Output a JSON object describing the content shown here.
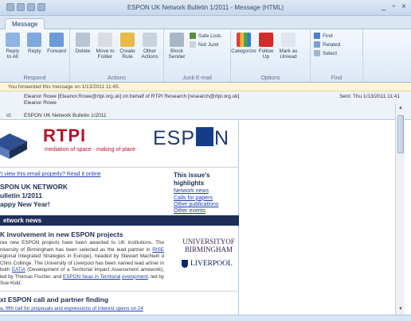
{
  "window": {
    "title": "ESPON UK Network Bulletin 1/2011 - Message (HTML)",
    "controls": [
      "_",
      "▫",
      "×"
    ]
  },
  "tabs": [
    "Message"
  ],
  "ribbon": {
    "groups": [
      {
        "label": "Respond",
        "buttons": [
          "Reply to All",
          "Reply",
          "Forward"
        ]
      },
      {
        "label": "Actions",
        "buttons": [
          "Delete",
          "Move to Folder",
          "Create Rule",
          "Other Actions"
        ]
      },
      {
        "label": "Junk E-mail",
        "buttons": [
          "Block Sender",
          "Safe Lists",
          "Not Junk"
        ]
      },
      {
        "label": "Options",
        "buttons": [
          "Categorize",
          "Follow Up",
          "Mark as Unread"
        ]
      },
      {
        "label": "Find",
        "buttons": [
          "Find",
          "Related",
          "Select"
        ]
      }
    ]
  },
  "infobar": "You forwarded this message on 1/13/2011 11:45.",
  "header": {
    "from": "Eleanor Rowe [Eleanor.Rowe@rtpi.org.uk] on behalf of RTPI Research [research@rtpi.org.uk]",
    "to": "Eleanor Rowe",
    "sent": "Sent:  Thu 1/13/2011 11:41",
    "subject_label": "ct:",
    "subject": "ESPON UK Network Bulletin 1/2011"
  },
  "newsletter": {
    "rtpi_name": "RTPI",
    "rtpi_tagline": "mediation of space · making of place",
    "espon_left": "ESP",
    "espon_right": "N",
    "view_link": "'t view this email properly? Read it online",
    "name_lines": [
      "SPON UK NETWORK",
      "ulletin 1/2011",
      "appy New Year!"
    ],
    "highlights": {
      "heading": "This issue's highlights",
      "links": [
        "Network news",
        "Calls for papers",
        "Other publications",
        "Other events"
      ]
    },
    "section": "etwork news",
    "article1_title": "K involvement in new ESPON projects",
    "article1_pre": "ree new ESPON projects have been awarded to UK institutions. The niversity of Birmingham has been selected as the lead partner in ",
    "article1_link1": "RISE",
    "article1_mid1": " egional Integrated Strategies in Europe), headed by Stewart MacNeill d Chris Collinge. The University of Liverpool has been named lead artner in both ",
    "article1_link2": "EATiA",
    "article1_mid2": " (Development of a Territorial Impact Assessment amework), led by Thomas Fischer, and ",
    "article1_link3": "ESPON Seas in Territorial",
    "article1_link4": "evelopment",
    "article1_post": ", led by Sue Kidd.",
    "uob": [
      "UNIVERSITYOF",
      "BIRMINGHAM"
    ],
    "uol": "LIVERPOOL",
    "article2_title": "xt ESPON call and partner finding",
    "article2_link": "a, fifth call for proposals and expressions of interest opens on 24"
  }
}
